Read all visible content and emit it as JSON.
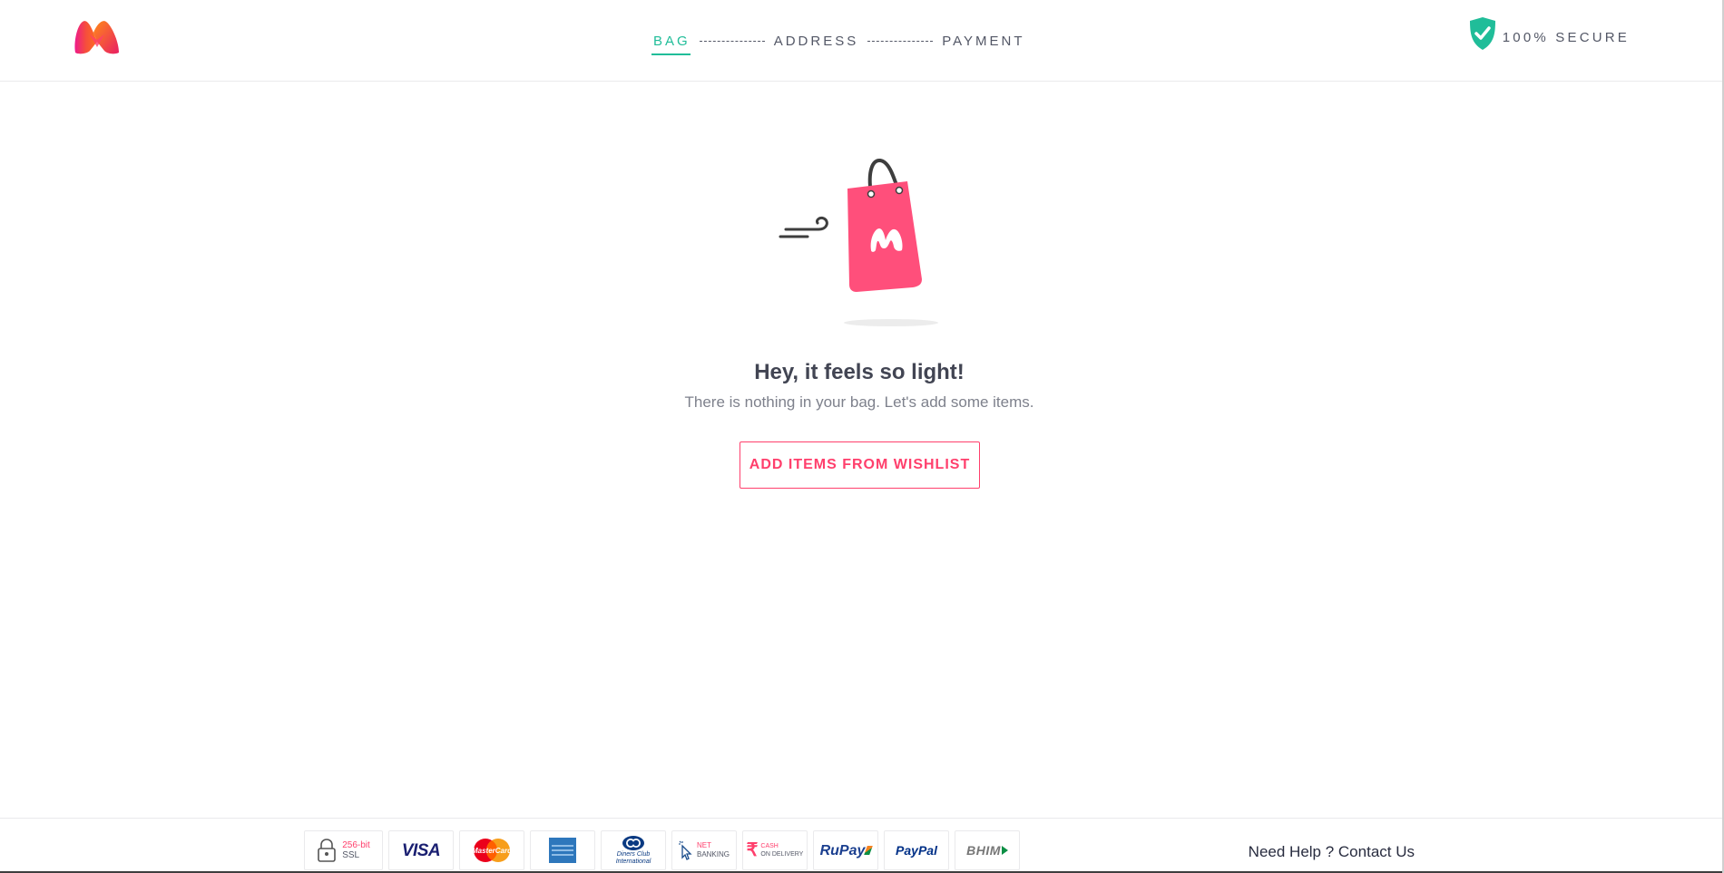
{
  "header": {
    "logo_name": "myntra-logo",
    "steps": [
      {
        "label": "BAG",
        "active": true
      },
      {
        "label": "ADDRESS",
        "active": false
      },
      {
        "label": "PAYMENT",
        "active": false
      }
    ],
    "secure_label": "100% SECURE",
    "secure_icon": "shield-check-icon"
  },
  "empty_bag": {
    "illustration": "shopping-bag-icon",
    "title": "Hey, it feels so light!",
    "subtitle": "There is nothing in your bag. Let's add some items.",
    "button_label": "ADD ITEMS FROM WISHLIST"
  },
  "footer": {
    "payment_methods": [
      {
        "name": "ssl-badge",
        "line1": "256-bit",
        "line2": "SSL"
      },
      {
        "name": "visa-logo",
        "label": "VISA"
      },
      {
        "name": "mastercard-logo",
        "label": "MasterCard"
      },
      {
        "name": "amex-logo",
        "label": ""
      },
      {
        "name": "diners-club-logo",
        "label": "Diners Club International"
      },
      {
        "name": "net-banking-logo",
        "line1": "NET",
        "line2": "BANKING"
      },
      {
        "name": "cash-on-delivery-logo",
        "line1": "CASH",
        "line2": "ON DELIVERY"
      },
      {
        "name": "rupay-logo",
        "label": "RuPay"
      },
      {
        "name": "paypal-logo",
        "label": "PayPal"
      },
      {
        "name": "bhim-logo",
        "label": "BHIM"
      }
    ],
    "help_prefix": "Need Help ? ",
    "help_link": "Contact Us"
  },
  "colors": {
    "brand_pink": "#ff3f6c",
    "accent_green": "#20bd99",
    "text_dark": "#282c3f",
    "text_muted": "#7e818c"
  }
}
